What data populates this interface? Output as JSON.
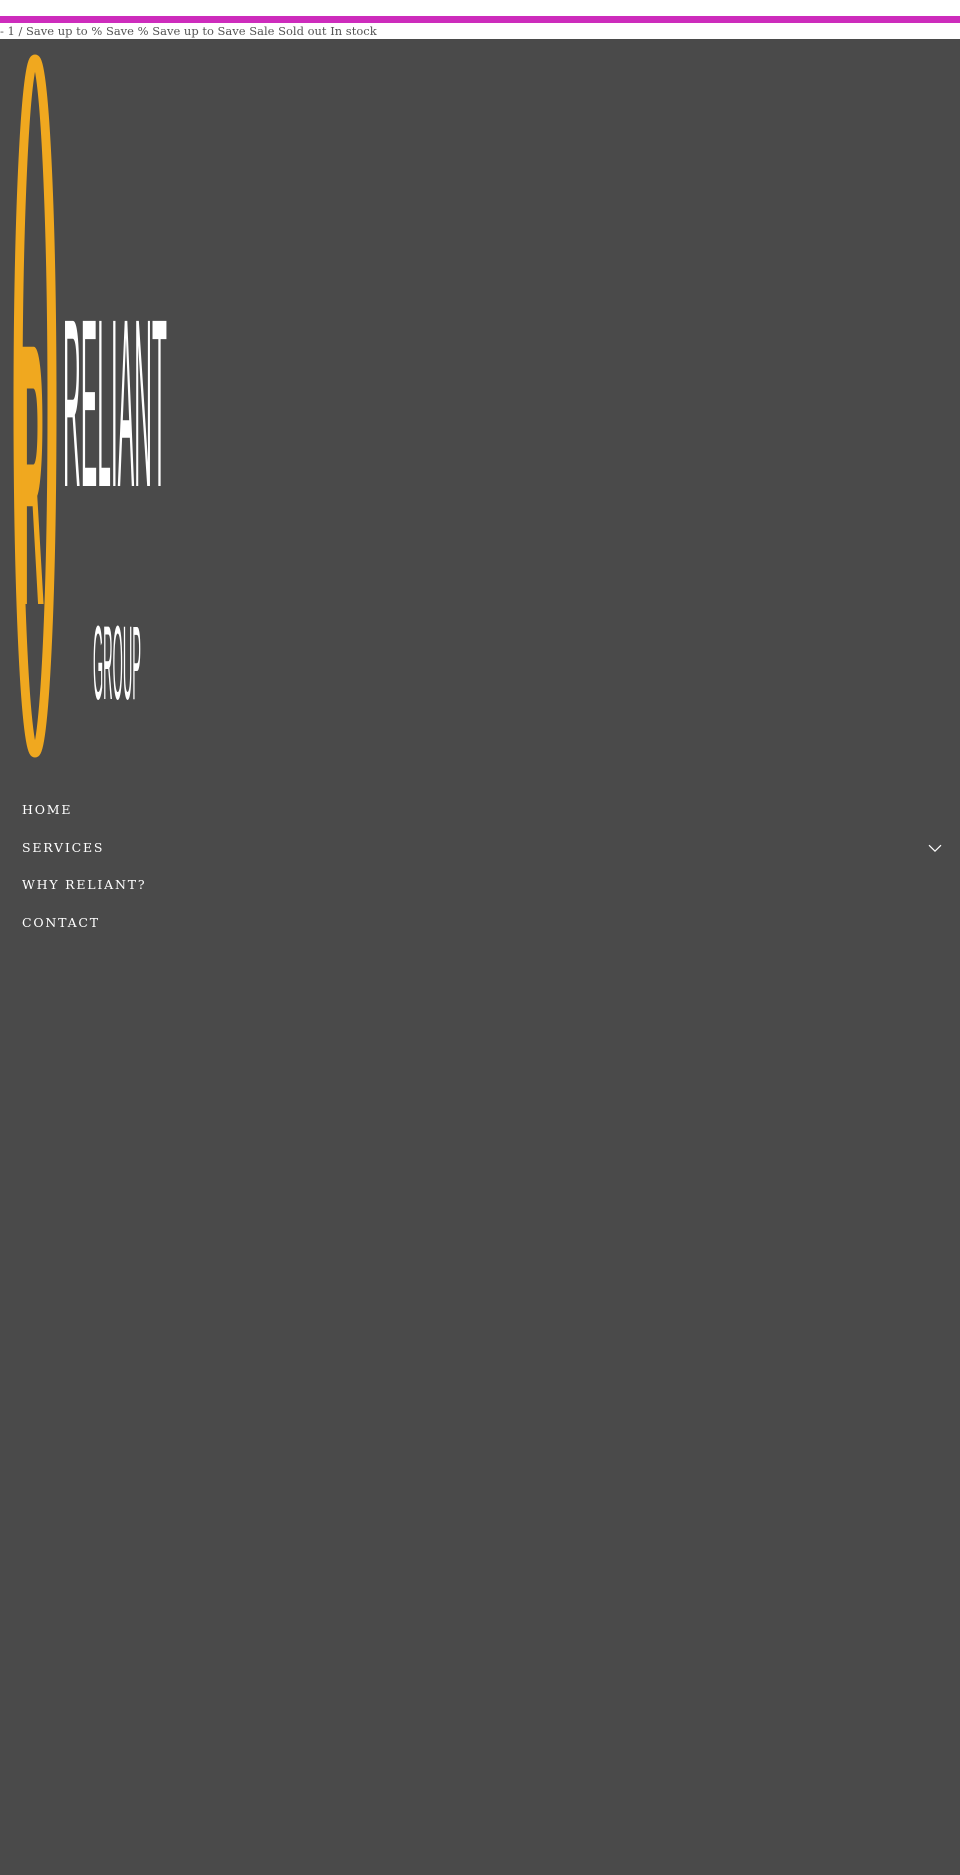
{
  "colors": {
    "accent_bar": "#cd2cbc",
    "drawer_background": "#4a4a4a",
    "logo_gold": "#f0a81f",
    "logo_text": "#ffffff"
  },
  "status_line": "- 1 / Save up to % Save % Save up to Save Sale Sold out In stock",
  "logo": {
    "wordmark_main": "RELIANT",
    "wordmark_sub": "GROUP",
    "monogram": "R"
  },
  "nav": {
    "items": [
      {
        "label": "HOME"
      },
      {
        "label": "SERVICES",
        "icon": "chevron-down-icon"
      },
      {
        "label": "WHY RELIANT?"
      },
      {
        "label": "CONTACT"
      }
    ]
  }
}
